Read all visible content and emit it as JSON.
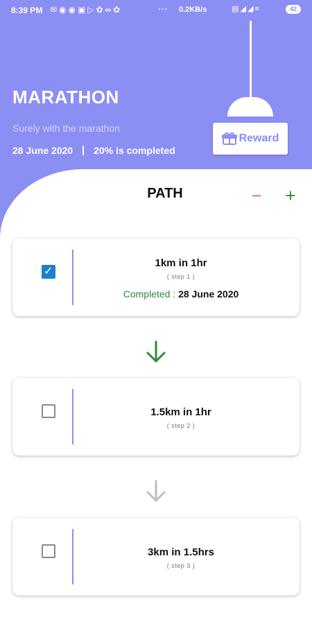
{
  "status_bar": {
    "time": "8:39 PM",
    "speed": "0.2KB/s",
    "battery": "42",
    "dots": "···"
  },
  "header": {
    "title": "MARATHON",
    "subtitle": "Surely with the marathon",
    "date": "28 June 2020",
    "progress": "20% is completed",
    "reward_label": "Reward"
  },
  "path": {
    "title": "PATH",
    "minus_label": "−",
    "plus_label": "+"
  },
  "steps": [
    {
      "title": "1km in 1hr",
      "step": "( step 1 )",
      "checked": true,
      "completed_label": "Completed : ",
      "completed_date": "28 June 2020"
    },
    {
      "title": "1.5km in 1hr",
      "step": "( step 2 )",
      "checked": false
    },
    {
      "title": "3km in 1.5hrs",
      "step": "( step 3 )",
      "checked": false
    }
  ],
  "colors": {
    "accent": "#8b8ef3",
    "completed": "#2e8b3a",
    "check": "#1f7fd1",
    "minus": "#e06b60",
    "arrow_done": "#2e8b3a",
    "arrow_pending": "#bdbdbd"
  }
}
